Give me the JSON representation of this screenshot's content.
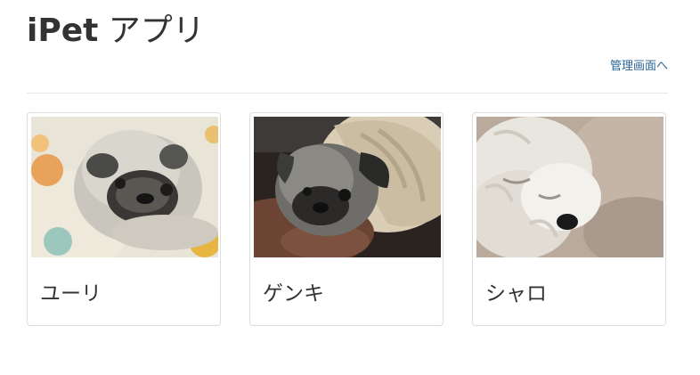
{
  "header": {
    "title_brand": "iPet",
    "title_rest": " アプリ",
    "admin_link": "管理画面へ"
  },
  "pets": [
    {
      "name": "ユーリ",
      "photo": "pug-on-cushion-photo"
    },
    {
      "name": "ゲンキ",
      "photo": "pug-in-blanket-photo"
    },
    {
      "name": "シャロ",
      "photo": "white-fluffy-dog-photo"
    }
  ]
}
